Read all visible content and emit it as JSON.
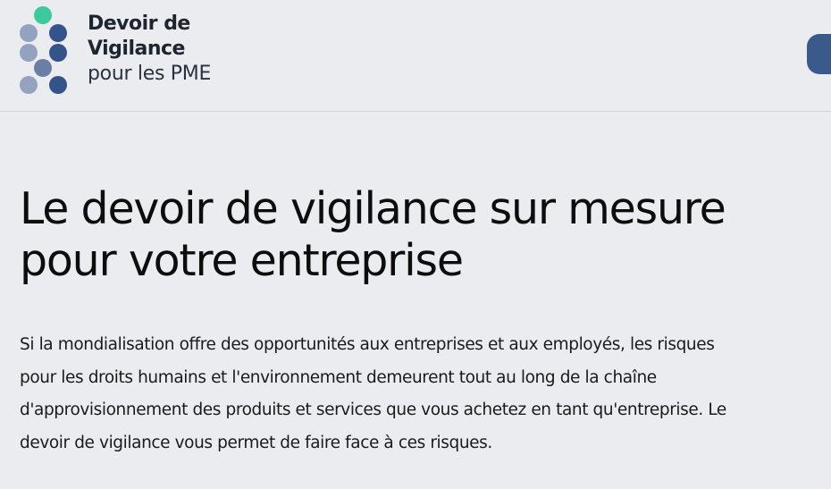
{
  "header": {
    "logo": {
      "line1": "Devoir de",
      "line2": "Vigilance",
      "line3": "pour les PME",
      "dot_colors": {
        "green": "#3ec99a",
        "light": "#93a3bf",
        "mid": "#6a7fa3",
        "dark": "#34538a"
      }
    },
    "accent_color": "#3a5a8c"
  },
  "hero": {
    "title_line1": "Le devoir de vigilance sur mesure",
    "title_line2": "pour votre entreprise",
    "paragraph": "Si la mondialisation offre des opportunités aux entreprises et aux employés, les risques pour les droits humains et l'environnement demeurent tout au long de la chaîne d'approvisionnement des produits et services que vous achetez en tant qu'entreprise. Le devoir de vigilance vous permet de faire face à ces risques."
  }
}
